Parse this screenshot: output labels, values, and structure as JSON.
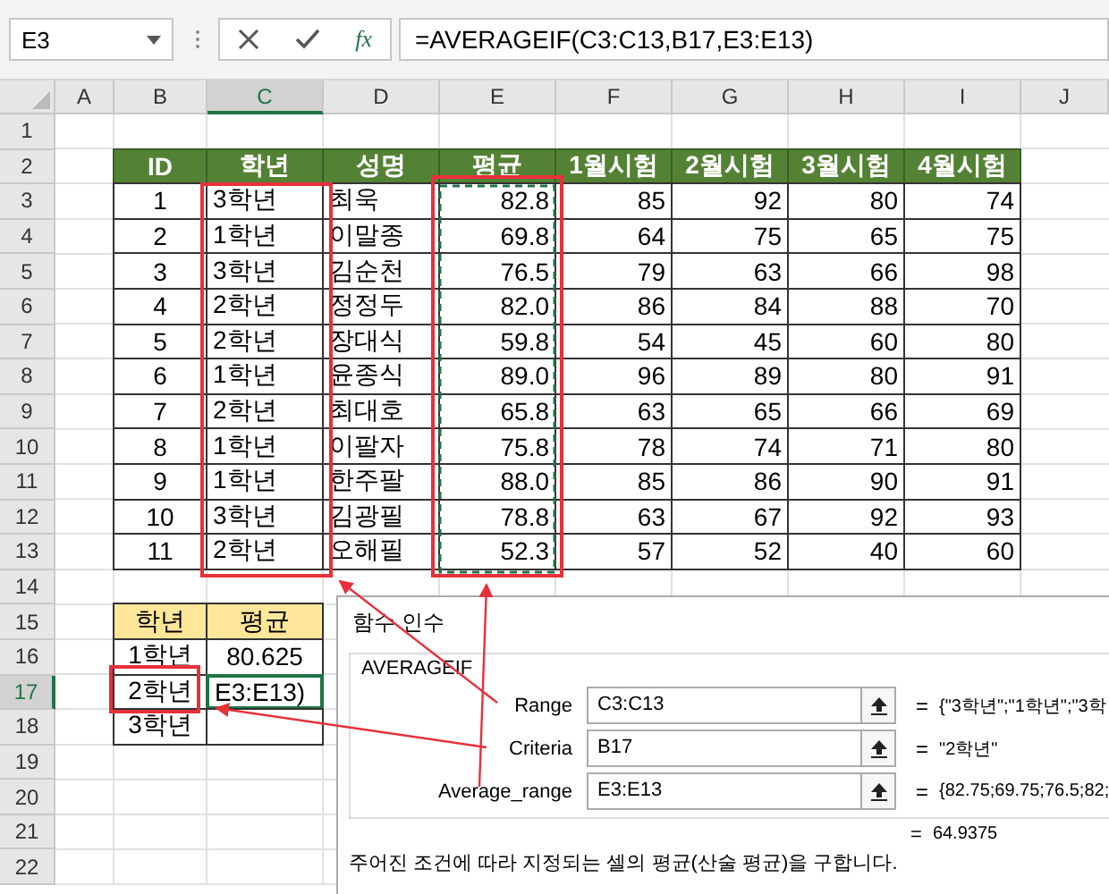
{
  "name_box": "E3",
  "formula_bar": {
    "function_button": "fx",
    "formula": "=AVERAGEIF(C3:C13,B17,E3:E13)"
  },
  "columns": [
    {
      "label": "A",
      "selected": false
    },
    {
      "label": "B",
      "selected": false
    },
    {
      "label": "C",
      "selected": true
    },
    {
      "label": "D",
      "selected": false
    },
    {
      "label": "E",
      "selected": false
    },
    {
      "label": "F",
      "selected": false
    },
    {
      "label": "G",
      "selected": false
    },
    {
      "label": "H",
      "selected": false
    },
    {
      "label": "I",
      "selected": false
    },
    {
      "label": "J",
      "selected": false
    }
  ],
  "rows": [
    {
      "label": "1",
      "selected": false
    },
    {
      "label": "2",
      "selected": false
    },
    {
      "label": "3",
      "selected": false
    },
    {
      "label": "4",
      "selected": false
    },
    {
      "label": "5",
      "selected": false
    },
    {
      "label": "6",
      "selected": false
    },
    {
      "label": "7",
      "selected": false
    },
    {
      "label": "8",
      "selected": false
    },
    {
      "label": "9",
      "selected": false
    },
    {
      "label": "10",
      "selected": false
    },
    {
      "label": "11",
      "selected": false
    },
    {
      "label": "12",
      "selected": false
    },
    {
      "label": "13",
      "selected": false
    },
    {
      "label": "14",
      "selected": false
    },
    {
      "label": "15",
      "selected": false
    },
    {
      "label": "16",
      "selected": false
    },
    {
      "label": "17",
      "selected": true
    },
    {
      "label": "18",
      "selected": false
    },
    {
      "label": "19",
      "selected": false
    },
    {
      "label": "20",
      "selected": false
    },
    {
      "label": "21",
      "selected": false
    },
    {
      "label": "22",
      "selected": false
    }
  ],
  "table": {
    "columns": [
      "ID",
      "학년",
      "성명",
      "평균",
      "1월시험",
      "2월시험",
      "3월시험",
      "4월시험"
    ],
    "rows": [
      [
        "1",
        "3학년",
        "최욱",
        "82.8",
        "85",
        "92",
        "80",
        "74"
      ],
      [
        "2",
        "1학년",
        "이말종",
        "69.8",
        "64",
        "75",
        "65",
        "75"
      ],
      [
        "3",
        "3학년",
        "김순천",
        "76.5",
        "79",
        "63",
        "66",
        "98"
      ],
      [
        "4",
        "2학년",
        "정정두",
        "82.0",
        "86",
        "84",
        "88",
        "70"
      ],
      [
        "5",
        "2학년",
        "장대식",
        "59.8",
        "54",
        "45",
        "60",
        "80"
      ],
      [
        "6",
        "1학년",
        "윤종식",
        "89.0",
        "96",
        "89",
        "80",
        "91"
      ],
      [
        "7",
        "2학년",
        "최대호",
        "65.8",
        "63",
        "65",
        "66",
        "69"
      ],
      [
        "8",
        "1학년",
        "이팔자",
        "75.8",
        "78",
        "74",
        "71",
        "80"
      ],
      [
        "9",
        "1학년",
        "한주팔",
        "88.0",
        "85",
        "86",
        "90",
        "91"
      ],
      [
        "10",
        "3학년",
        "김광필",
        "78.8",
        "63",
        "67",
        "92",
        "93"
      ],
      [
        "11",
        "2학년",
        "오해필",
        "52.3",
        "57",
        "52",
        "40",
        "60"
      ]
    ]
  },
  "summary": {
    "columns": [
      "학년",
      "평균"
    ],
    "rows": [
      {
        "grade": "1학년",
        "value": "80.625",
        "editing": false
      },
      {
        "grade": "2학년",
        "value": "E3:E13)",
        "editing": true
      },
      {
        "grade": "3학년",
        "editing": false
      }
    ]
  },
  "dialog": {
    "title": "함수 인수",
    "function_name": "AVERAGEIF",
    "arguments": [
      {
        "label": "Range",
        "value": "C3:C13",
        "equals": "=",
        "result": "{\"3학년\";\"1학년\";\"3학"
      },
      {
        "label": "Criteria",
        "value": "B17",
        "equals": "=",
        "result": "\"2학년\""
      },
      {
        "label": "Average_range",
        "value": "E3:E13",
        "equals": "=",
        "result": "{82.75;69.75;76.5;82;"
      }
    ],
    "total": {
      "equals": "=",
      "value": "64.9375"
    },
    "description": "주어진 조건에 따라 지정되는 셀의 평균(산술 평균)을 구합니다."
  }
}
